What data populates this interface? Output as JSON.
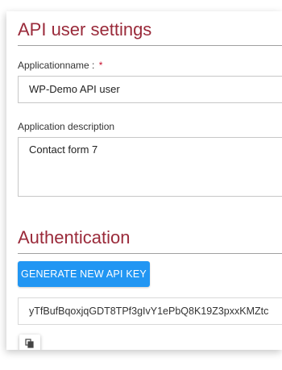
{
  "settings": {
    "title": "API user settings",
    "app_name_label": "Applicationname :",
    "required_marker": "*",
    "app_name_value": "WP-Demo API user",
    "description_label": "Application description",
    "description_value": "Contact form 7"
  },
  "authentication": {
    "title": "Authentication",
    "generate_button_label": "GENERATE NEW API KEY",
    "api_key_value": "yTfBufBqoxjqGDT8TPf3gIvY1ePbQ8K19Z3pxxKMZtc",
    "copy_icon": "copy-icon"
  },
  "colors": {
    "title": "#9a2a3a",
    "required": "#c8102e",
    "primary_button": "#2196f3"
  }
}
